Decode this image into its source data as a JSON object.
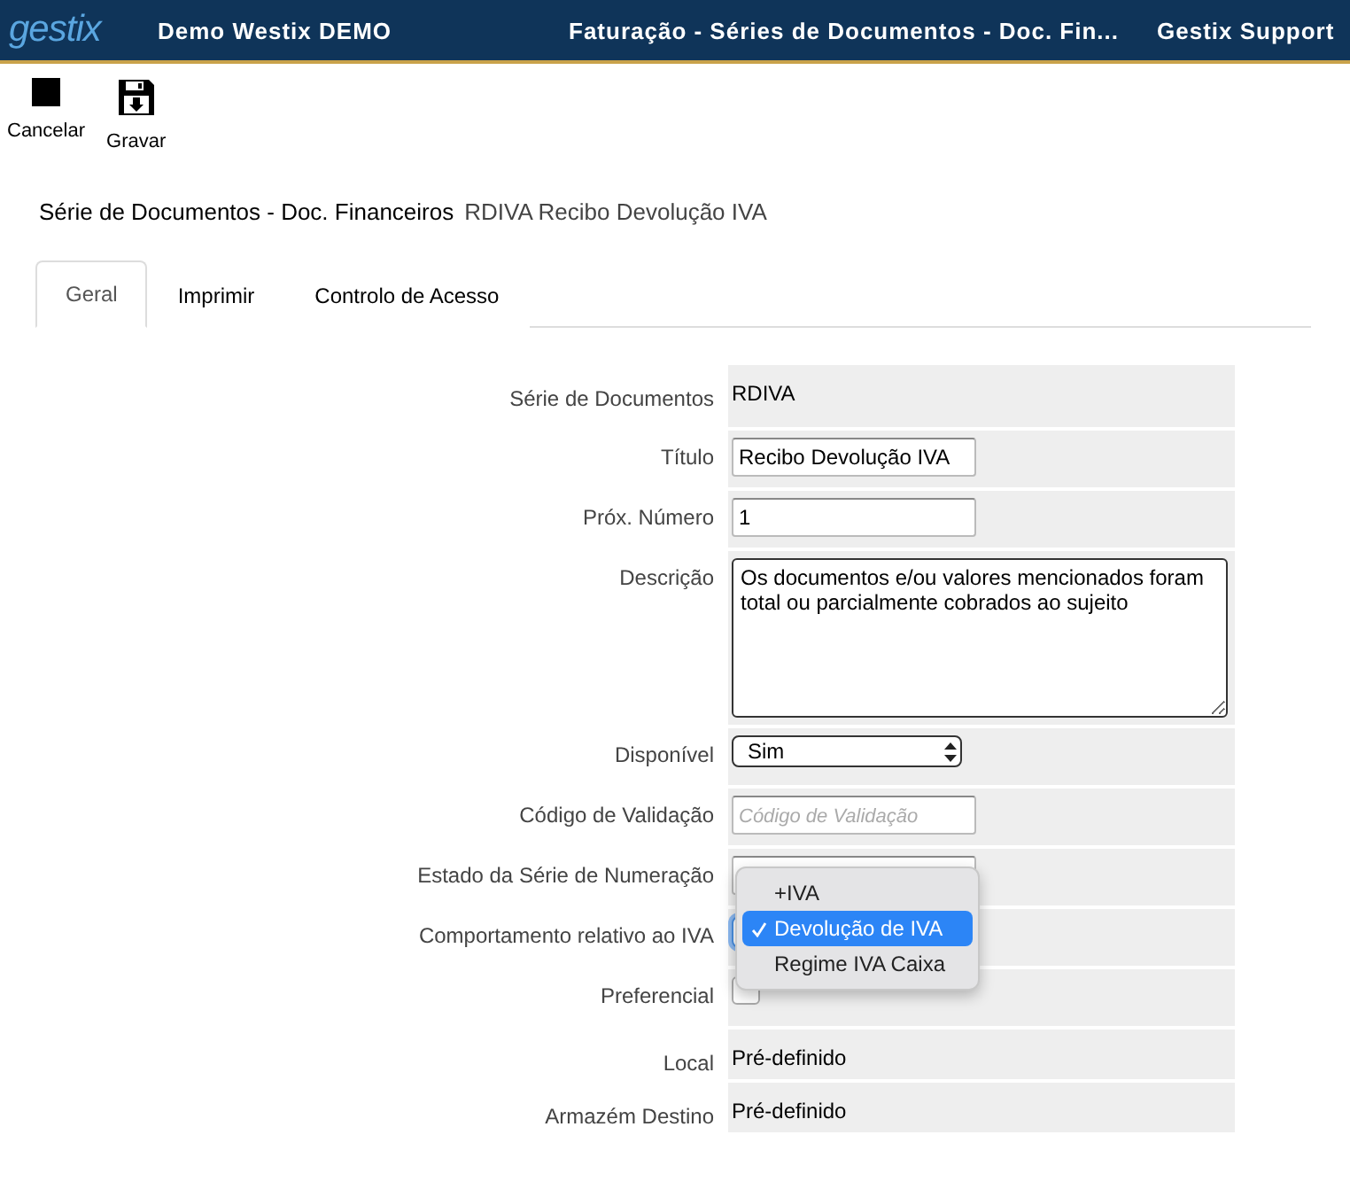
{
  "header": {
    "logo": "gestix",
    "company": "Demo Westix DEMO",
    "title": "Faturação - Séries de Documentos - Doc. Fin...",
    "user": "Gestix Support"
  },
  "toolbar": [
    {
      "label": "Cancelar",
      "kind": "stop"
    },
    {
      "label": "Gravar",
      "kind": "save"
    }
  ],
  "breadcrumb": {
    "section": "Série de Documentos - Doc. Financeiros",
    "record": "RDIVA Recibo Devolução IVA"
  },
  "tabs": [
    {
      "label": "Geral",
      "selected": true
    },
    {
      "label": "Imprimir",
      "selected": false
    },
    {
      "label": "Controlo de Acesso",
      "selected": false
    }
  ],
  "fields": [
    {
      "label": "Série de Documentos",
      "kind": "text",
      "value": "RDIVA"
    },
    {
      "label": "Título",
      "kind": "input",
      "value": "Recibo Devolução IVA"
    },
    {
      "label": "Próx. Número",
      "kind": "number",
      "value": "1"
    },
    {
      "label": "Descrição",
      "kind": "textarea",
      "value": "Os documentos e/ou valores mencionados foram total ou parcialmente cobrados ao sujeito"
    },
    {
      "label": "Disponível",
      "kind": "select",
      "value": "Sim"
    },
    {
      "label": "Código de Validação",
      "kind": "input",
      "placeholder": "Código de Validação"
    },
    {
      "label": "Estado da Série de Numeração",
      "kind": "input"
    },
    {
      "label": "Comportamento relativo ao IVA",
      "kind": "dropdown",
      "options": [
        {
          "label": "+IVA",
          "selected": false
        },
        {
          "label": "Devolução de IVA",
          "selected": true
        },
        {
          "label": "Regime IVA Caixa",
          "selected": false
        }
      ]
    },
    {
      "label": "Preferencial",
      "kind": "checkbox",
      "checked": false
    },
    {
      "label": "Local",
      "kind": "text",
      "value": "Pré-definido"
    },
    {
      "label": "Armazém Destino",
      "kind": "text",
      "value": "Pré-definido"
    }
  ]
}
